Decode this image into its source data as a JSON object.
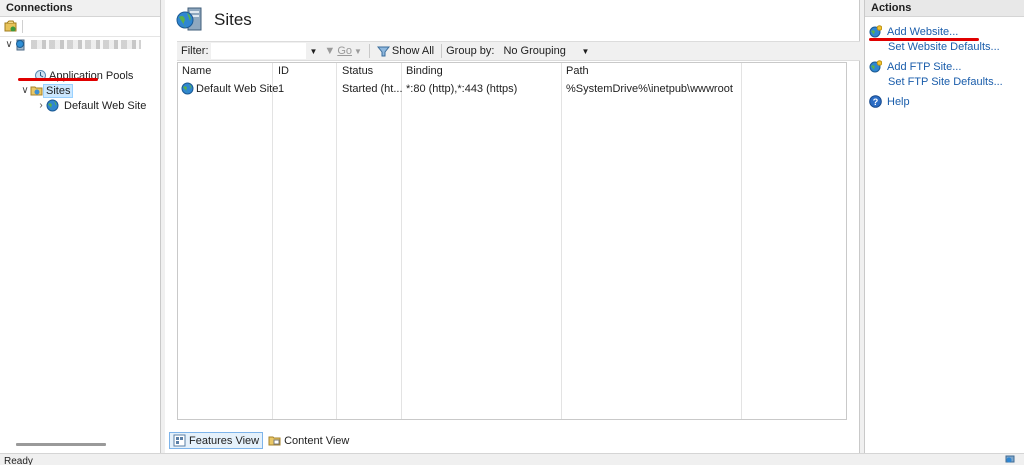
{
  "connections": {
    "title": "Connections",
    "tree": {
      "app_pools": "Application Pools",
      "sites": "Sites",
      "default_site": "Default Web Site"
    }
  },
  "center": {
    "title": "Sites",
    "filter": {
      "label": "Filter:",
      "go": "Go",
      "show_all": "Show All",
      "group_by_label": "Group by:",
      "group_by_value": "No Grouping"
    },
    "columns": [
      "Name",
      "ID",
      "Status",
      "Binding",
      "Path"
    ],
    "rows": [
      {
        "name": "Default Web Site",
        "id": "1",
        "status": "Started (ht...",
        "binding": "*:80 (http),*:443 (https)",
        "path": "%SystemDrive%\\inetpub\\wwwroot"
      }
    ],
    "views": {
      "features": "Features View",
      "content": "Content View"
    }
  },
  "actions": {
    "title": "Actions",
    "items": {
      "add_website": "Add Website...",
      "set_website_defaults": "Set Website Defaults...",
      "add_ftp": "Add FTP Site...",
      "set_ftp_defaults": "Set FTP Site Defaults...",
      "help": "Help"
    }
  },
  "status": "Ready",
  "colors": {
    "link": "#1a5dab",
    "annotation": "#e00000",
    "selection": "#cce8ff"
  }
}
